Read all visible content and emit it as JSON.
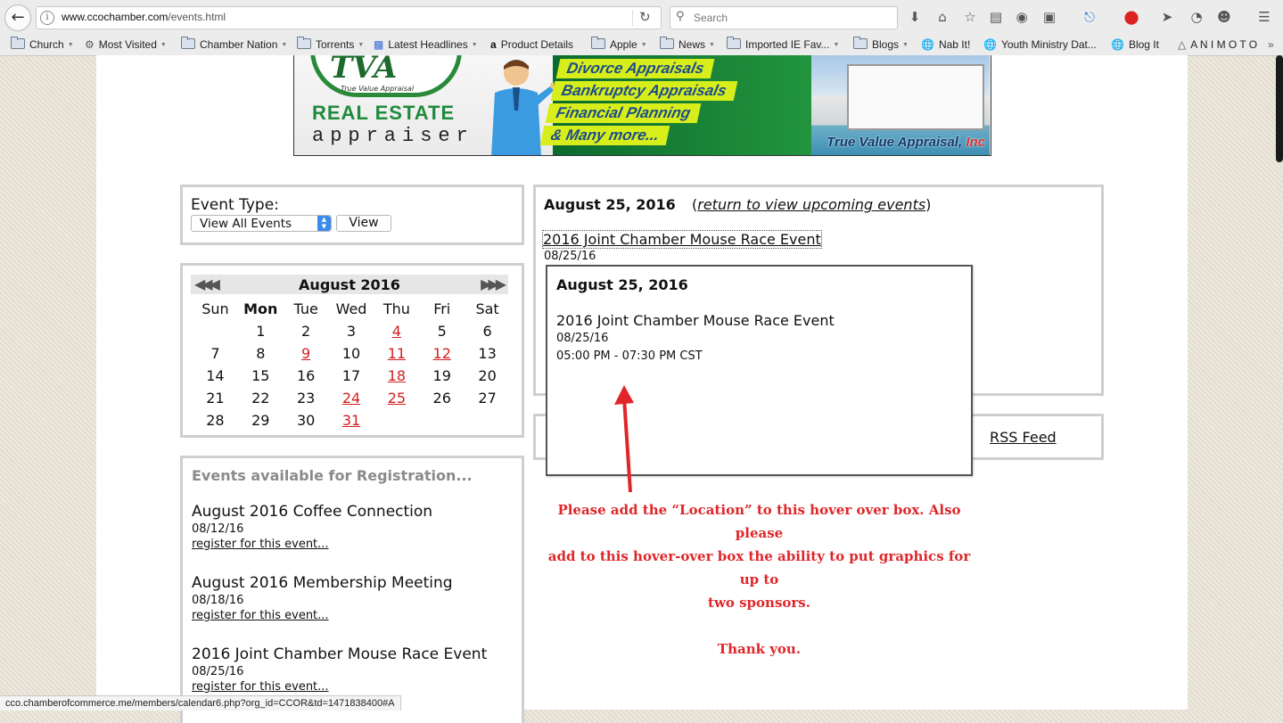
{
  "browser": {
    "url_host": "www.ccochamber.com",
    "url_path": "/events.html",
    "search_placeholder": "Search",
    "bookmarks": [
      {
        "label": "Church"
      },
      {
        "label": "Most Visited"
      },
      {
        "label": "Chamber Nation"
      },
      {
        "label": "Torrents"
      },
      {
        "label": "Latest Headlines"
      },
      {
        "label": "Product Details"
      },
      {
        "label": "Apple"
      },
      {
        "label": "News"
      },
      {
        "label": "Imported IE Fav..."
      },
      {
        "label": "Blogs"
      },
      {
        "label": "Nab It!"
      },
      {
        "label": "Youth Ministry Dat..."
      },
      {
        "label": "Blog It"
      },
      {
        "label": "A N I M O T O"
      }
    ],
    "status_url": "cco.chamberofcommerce.me/members/calendar6.php?org_id=CCOR&td=1471838400#A"
  },
  "banner": {
    "logo": "TVA",
    "logo_tag": "True Value Appraisal",
    "title_line1": "REAL ESTATE",
    "title_line2": "appraiser",
    "services": [
      "Divorce Appraisals",
      "Bankruptcy Appraisals",
      "Financial Planning",
      "& Many more..."
    ],
    "brand": "True Value Appraisal",
    "brand_suffix": "Inc"
  },
  "event_type": {
    "label": "Event Type:",
    "selected": "View All Events",
    "button": "View"
  },
  "calendar": {
    "prev": "◀◀◀",
    "next": "▶▶▶",
    "month": "August 2016",
    "days": [
      "Sun",
      "Mon",
      "Tue",
      "Wed",
      "Thu",
      "Fri",
      "Sat"
    ],
    "weeks": [
      [
        "",
        "1",
        "2",
        "3",
        "4",
        "5",
        "6"
      ],
      [
        "7",
        "8",
        "9",
        "10",
        "11",
        "12",
        "13"
      ],
      [
        "14",
        "15",
        "16",
        "17",
        "18",
        "19",
        "20"
      ],
      [
        "21",
        "22",
        "23",
        "24",
        "25",
        "26",
        "27"
      ],
      [
        "28",
        "29",
        "30",
        "31",
        "",
        "",
        ""
      ]
    ],
    "event_days": [
      "4",
      "9",
      "11",
      "12",
      "18",
      "24",
      "25",
      "31"
    ],
    "event_color": "#d21f1f"
  },
  "registration": {
    "title": "Events available for Registration...",
    "items": [
      {
        "name": "August 2016 Coffee Connection",
        "date": "08/12/16",
        "link": "register for this event..."
      },
      {
        "name": "August 2016 Membership Meeting",
        "date": "08/18/16",
        "link": "register for this event..."
      },
      {
        "name": "2016 Joint Chamber Mouse Race Event",
        "date": "08/25/16",
        "link": "register for this event..."
      }
    ]
  },
  "event_detail": {
    "date": "August 25, 2016",
    "return_open": "(",
    "return_link": "return to view upcoming events",
    "return_close": ")",
    "title": "2016 Joint Chamber Mouse Race Event",
    "event_date": "08/25/16"
  },
  "rss": {
    "label": "RSS Feed"
  },
  "hover_box": {
    "date": "August 25, 2016",
    "title": "2016 Joint Chamber Mouse Race Event",
    "event_date": "08/25/16",
    "time": "05:00 PM - 07:30 PM CST"
  },
  "annotation": {
    "line1": "Please add the “Location” to this hover over box.  Also please",
    "line2": "add to this hover-over box the ability to put graphics for up to",
    "line3": "two sponsors.",
    "thanks": "Thank you.",
    "color": "#e0262a"
  }
}
